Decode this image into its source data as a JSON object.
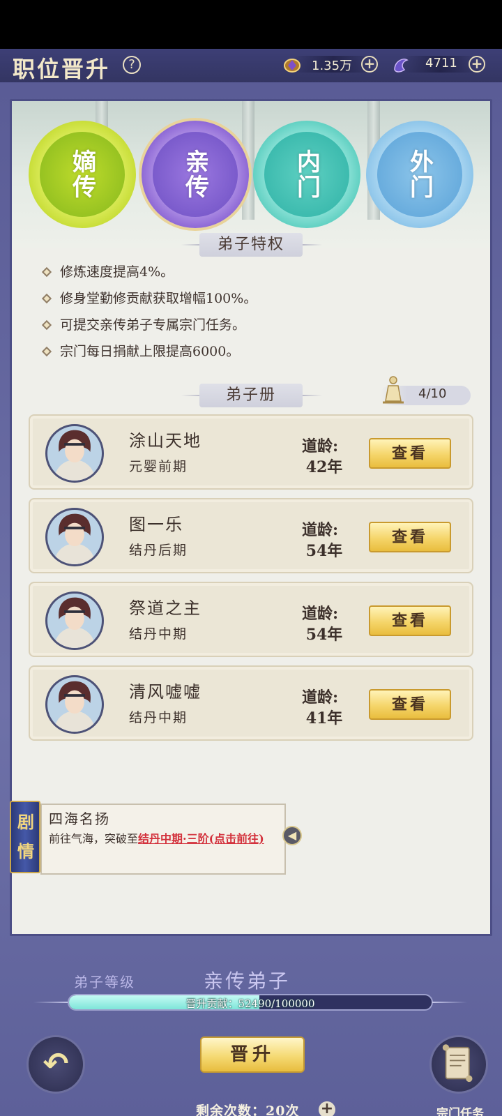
{
  "header": {
    "title": "职位晋升",
    "help_icon": "question-mark",
    "resources": [
      {
        "icon": "spirit-stone-icon",
        "value": "1.35万"
      },
      {
        "icon": "crystal-icon",
        "value": "4711"
      }
    ]
  },
  "ranks": [
    {
      "label": "嫡传",
      "color": "#b7d82a"
    },
    {
      "label": "亲传",
      "color": "#7b5bd0"
    },
    {
      "label": "内门",
      "color": "#3cbcae"
    },
    {
      "label": "外门",
      "color": "#6fb3e3"
    }
  ],
  "privileges": {
    "title": "弟子特权",
    "items": [
      "修炼速度提高4%。",
      "修身堂勤修贡献获取增幅100%。",
      "可提交亲传弟子专属宗门任务。",
      "宗门每日捐献上限提高6000。"
    ]
  },
  "roster": {
    "title": "弟子册",
    "count": "4/10",
    "age_label": "道龄:",
    "view_label": "查看",
    "disciples": [
      {
        "name": "涂山天地",
        "rank": "元婴前期",
        "age": "42年"
      },
      {
        "name": "图一乐",
        "rank": "结丹后期",
        "age": "54年"
      },
      {
        "name": "祭道之主",
        "rank": "结丹中期",
        "age": "54年"
      },
      {
        "name": "清风嘘嘘",
        "rank": "结丹中期",
        "age": "41年"
      }
    ]
  },
  "story": {
    "tab_label_1": "剧",
    "tab_label_2": "情",
    "title": "四海名扬",
    "desc_prefix": "前往气海，突破至",
    "desc_highlight": "结丹中期·三阶(点击前往)"
  },
  "bottom": {
    "level_label": "弟子等级",
    "level_value": "亲传弟子",
    "progress_label": "晋升贡献：52490/100000",
    "progress_fraction": 0.5249,
    "promote_label": "晋升",
    "remaining_label": "剩余次数：20次",
    "task_label": "宗门任务"
  }
}
